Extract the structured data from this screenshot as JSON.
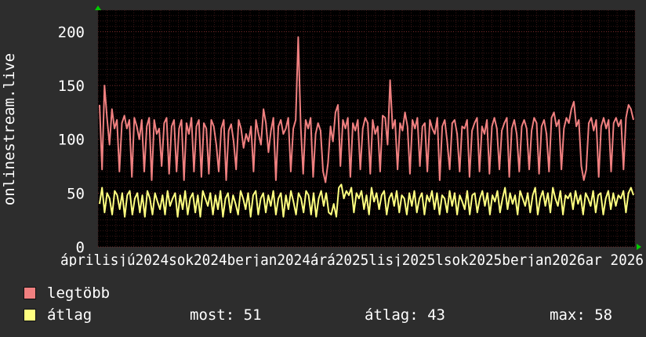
{
  "chart_data": {
    "type": "line",
    "ylabel": "onlinestream.live",
    "ylim": [
      0,
      220
    ],
    "y_ticks": [
      0,
      50,
      100,
      150,
      200
    ],
    "x_tick_labels": [
      "április",
      "július",
      "2024",
      "október",
      "2024",
      "január",
      "2024",
      "március",
      "április",
      "2025",
      "július",
      "2025",
      "október",
      "2025",
      "január",
      "2026",
      "március",
      "2026"
    ],
    "x_tick_labels_raw": "áprilisjú2024sok2024berjan2024árá2025lisj2025lsok2025berjan2026ar 2026",
    "grid": true,
    "series": [
      {
        "name": "legtöbb",
        "color": "#f08080",
        "values": [
          132,
          72,
          150,
          120,
          95,
          128,
          110,
          118,
          70,
          115,
          122,
          110,
          118,
          65,
          120,
          112,
          100,
          118,
          70,
          112,
          120,
          62,
          118,
          105,
          110,
          75,
          115,
          120,
          68,
          112,
          118,
          70,
          110,
          118,
          62,
          115,
          105,
          120,
          70,
          112,
          118,
          65,
          115,
          110,
          68,
          118,
          112,
          95,
          70,
          110,
          118,
          62,
          108,
          114,
          98,
          72,
          118,
          110,
          92,
          105,
          98,
          112,
          70,
          118,
          105,
          95,
          128,
          115,
          88,
          108,
          120,
          62,
          112,
          118,
          105,
          110,
          120,
          70,
          110,
          118,
          195,
          112,
          68,
          118,
          110,
          120,
          65,
          105,
          115,
          108,
          70,
          60,
          78,
          112,
          98,
          125,
          132,
          75,
          118,
          110,
          120,
          65,
          115,
          108,
          118,
          72,
          110,
          120,
          115,
          68,
          118,
          105,
          112,
          70,
          122,
          120,
          95,
          155,
          110,
          118,
          72,
          115,
          108,
          125,
          112,
          68,
          118,
          110,
          120,
          75,
          112,
          115,
          70,
          118,
          110,
          105,
          120,
          62,
          112,
          118,
          98,
          72,
          115,
          118,
          105,
          70,
          112,
          110,
          118,
          65,
          108,
          115,
          120,
          70,
          112,
          105,
          118,
          68,
          112,
          120,
          110,
          72,
          108,
          115,
          120,
          65,
          110,
          118,
          105,
          70,
          112,
          118,
          110,
          72,
          108,
          120,
          115,
          68,
          112,
          118,
          105,
          70,
          120,
          125,
          112,
          118,
          72,
          110,
          120,
          115,
          128,
          135,
          112,
          118,
          75,
          62,
          72,
          115,
          120,
          108,
          118,
          65,
          112,
          120,
          110,
          118,
          70,
          115,
          120,
          112,
          118,
          72,
          120,
          132,
          128,
          118
        ],
        "display_values": [
          [
            "max",
            195
          ]
        ]
      },
      {
        "name": "átlag",
        "color": "#ffff80",
        "values": [
          40,
          55,
          32,
          50,
          45,
          30,
          52,
          48,
          35,
          50,
          28,
          48,
          52,
          30,
          45,
          50,
          32,
          48,
          28,
          52,
          45,
          30,
          50,
          42,
          35,
          48,
          30,
          52,
          38,
          45,
          50,
          28,
          48,
          35,
          52,
          30,
          45,
          50,
          32,
          48,
          28,
          52,
          45,
          38,
          50,
          30,
          48,
          35,
          52,
          28,
          45,
          50,
          32,
          48,
          40,
          30,
          52,
          45,
          35,
          50,
          28,
          48,
          52,
          30,
          45,
          50,
          32,
          48,
          38,
          52,
          30,
          45,
          50,
          28,
          48,
          35,
          52,
          42,
          30,
          50,
          45,
          32,
          52,
          48,
          30,
          50,
          28,
          45,
          52,
          38,
          50,
          32,
          30,
          40,
          28,
          55,
          58,
          45,
          52,
          48,
          55,
          32,
          50,
          45,
          52,
          35,
          48,
          30,
          55,
          42,
          50,
          35,
          48,
          52,
          30,
          45,
          50,
          38,
          52,
          32,
          48,
          45,
          30,
          50,
          38,
          52,
          32,
          45,
          50,
          30,
          48,
          42,
          52,
          35,
          50,
          30,
          48,
          45,
          32,
          52,
          38,
          50,
          30,
          48,
          42,
          35,
          52,
          30,
          48,
          50,
          32,
          45,
          52,
          38,
          50,
          30,
          48,
          42,
          52,
          32,
          45,
          55,
          35,
          50,
          40,
          48,
          30,
          52,
          45,
          38,
          50,
          32,
          48,
          55,
          30,
          45,
          52,
          38,
          50,
          32,
          55,
          45,
          38,
          52,
          30,
          48,
          45,
          50,
          35,
          52,
          40,
          48,
          30,
          50,
          45,
          38,
          52,
          32,
          48,
          50,
          30,
          45,
          52,
          35,
          50,
          38,
          48,
          45,
          52,
          32,
          50,
          55,
          48
        ],
        "now": 51,
        "avg": 43,
        "max": 58
      }
    ],
    "legend": [
      {
        "label": "legtöbb",
        "color": "#f08080"
      },
      {
        "label": "átlag",
        "color": "#ffff80"
      }
    ]
  },
  "stats": {
    "now": "most: 51",
    "avg": "átlag: 43",
    "max": "max: 58"
  }
}
